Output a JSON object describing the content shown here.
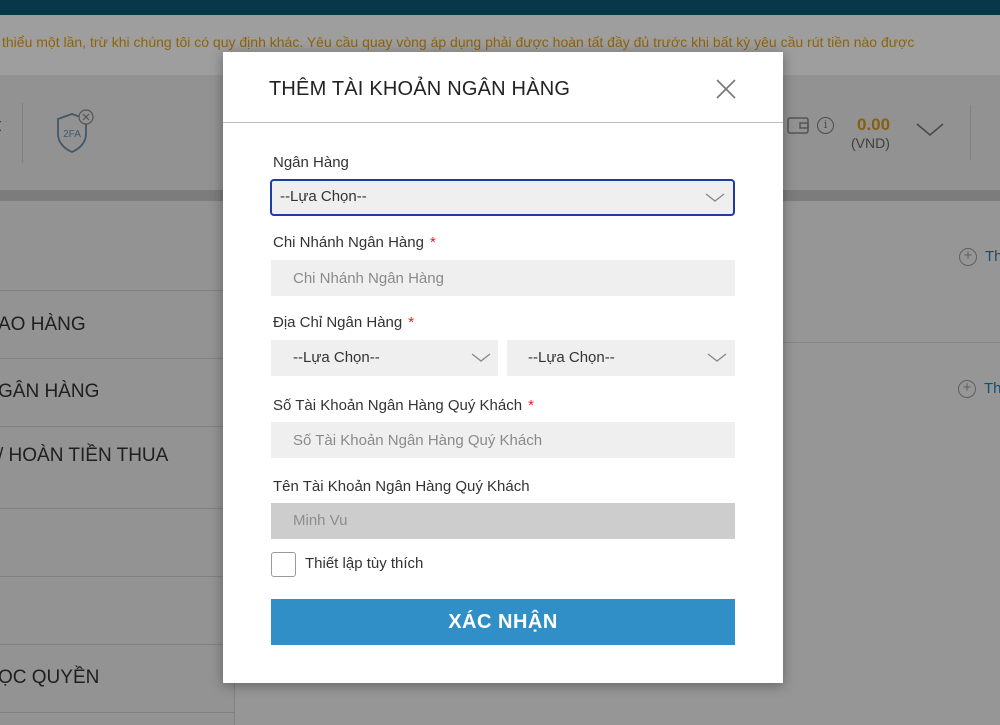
{
  "background": {
    "marquee_text": "thiểu một lần, trừ khi chúng tôi có quy định khác. Yêu cầu quay vòng áp dụng phải được hoàn tất đầy đủ trước khi bất kỳ yêu cầu rút tiền nào được",
    "header_left_text": "t",
    "twofa_label": "2FA",
    "info_glyph": "i",
    "balance": "0.00",
    "currency": "(VND)",
    "sidebar_items": [
      {
        "label": "AO HÀNG"
      },
      {
        "label": "GÂN HÀNG"
      },
      {
        "label": "/ HOÀN TIỀN THUA"
      },
      {
        "label": ""
      },
      {
        "label": ""
      },
      {
        "label": "ỌC QUYỀN"
      }
    ],
    "add_links": [
      {
        "label": "Th"
      },
      {
        "label": "Th"
      }
    ]
  },
  "modal": {
    "title": "THÊM TÀI KHOẢN NGÂN HÀNG",
    "bank": {
      "label": "Ngân Hàng",
      "value": "--Lựa Chọn--"
    },
    "branch": {
      "label": "Chi Nhánh Ngân Hàng",
      "required_mark": "*",
      "placeholder": "Chi Nhánh Ngân Hàng"
    },
    "address": {
      "label": "Địa Chỉ Ngân Hàng",
      "required_mark": "*",
      "province_value": "--Lựa Chọn--",
      "district_value": "--Lựa Chọn--"
    },
    "account_number": {
      "label": "Số Tài Khoản Ngân Hàng Quý Khách",
      "required_mark": "*",
      "placeholder": "Số Tài Khoản Ngân Hàng Quý Khách"
    },
    "account_name": {
      "label": "Tên Tài Khoản Ngân Hàng Quý Khách",
      "value": "Minh Vu"
    },
    "custom_setting": {
      "label": "Thiết lập tùy thích",
      "checked": false
    },
    "submit_label": "XÁC NHẬN"
  },
  "colors": {
    "primary_button": "#2f8fc6",
    "focus_border": "#1d3e9e",
    "required": "#e02020",
    "balance": "#d89b16",
    "top_bar": "#0d5a74"
  }
}
